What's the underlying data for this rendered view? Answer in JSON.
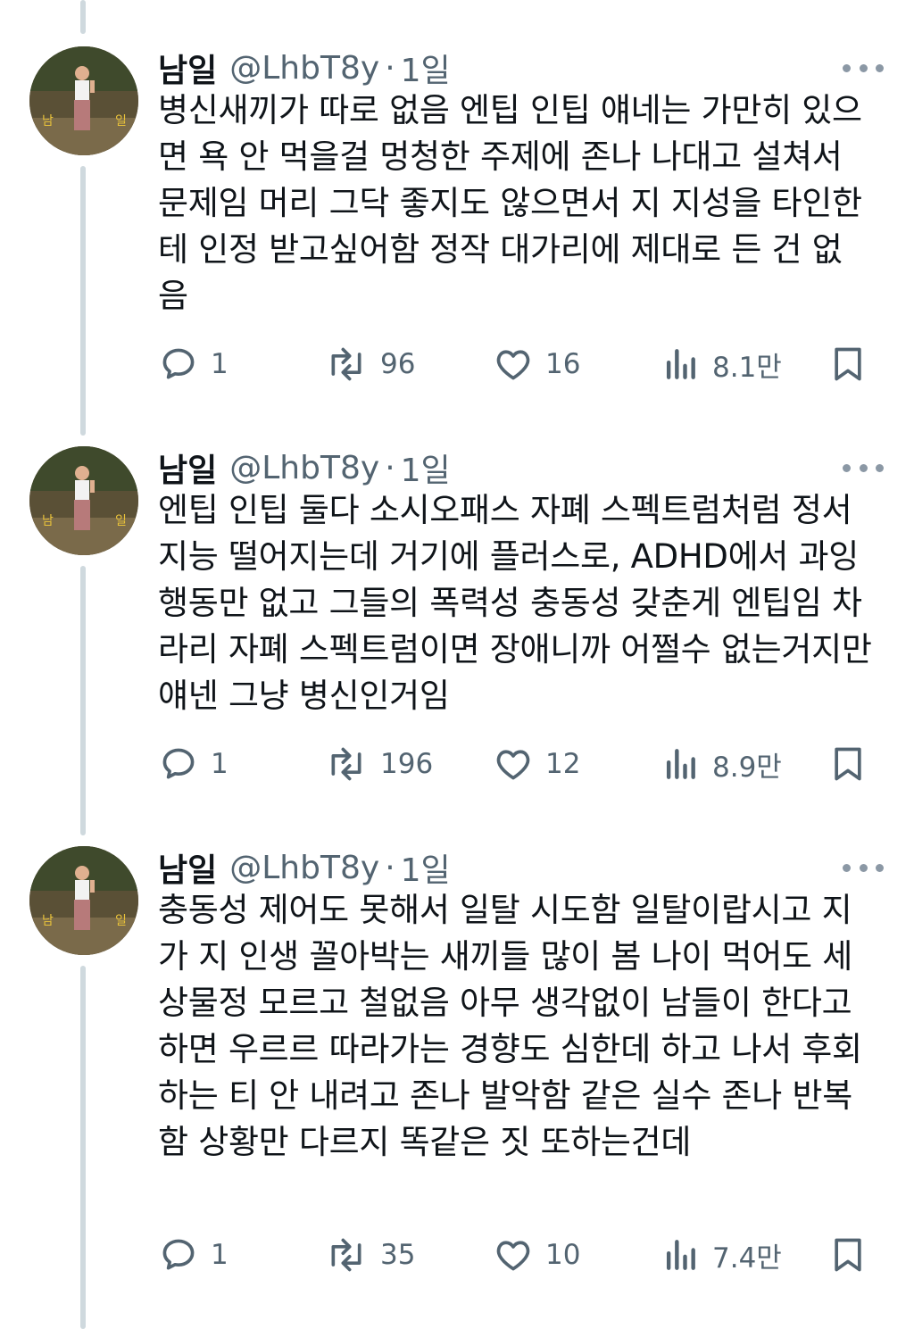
{
  "tweets": [
    {
      "name": "남일",
      "handle": "@LhbT8y",
      "separator": "·",
      "time": "1일",
      "text": "병신새끼가 따로 없음 엔팁 인팁 얘네는 가만히 있으면 욕 안 먹을걸 멍청한 주제에 존나 나대고 설쳐서 문제임 머리 그닥 좋지도 않으면서 지 지성을 타인한테 인정 받고싶어함 정작 대가리에 제대로 든 건 없음",
      "replies": "1",
      "retweets": "96",
      "likes": "16",
      "views": "8.1만"
    },
    {
      "name": "남일",
      "handle": "@LhbT8y",
      "separator": "·",
      "time": "1일",
      "text": "엔팁 인팁 둘다 소시오패스 자폐 스펙트럼처럼 정서지능 떨어지는데 거기에 플러스로, ADHD에서 과잉행동만 없고 그들의 폭력성 충동성 갖춘게 엔팁임 차라리 자폐 스펙트럼이면 장애니까 어쩔수 없는거지만 얘넨 그냥 병신인거임",
      "replies": "1",
      "retweets": "196",
      "likes": "12",
      "views": "8.9만"
    },
    {
      "name": "남일",
      "handle": "@LhbT8y",
      "separator": "·",
      "time": "1일",
      "text": "충동성 제어도 못해서 일탈 시도함 일탈이랍시고 지가 지 인생 꼴아박는 새끼들 많이 봄 나이 먹어도 세상물정 모르고 철없음 아무 생각없이 남들이 한다고 하면 우르르 따라가는 경향도 심한데 하고 나서 후회하는 티 안 내려고 존나 발악함 같은 실수 존나 반복함 상황만 다르지 똑같은 짓 또하는건데",
      "replies": "1",
      "retweets": "35",
      "likes": "10",
      "views": "7.4만"
    }
  ],
  "icons": {
    "reply": "reply-icon",
    "retweet": "retweet-icon",
    "like": "heart-icon",
    "views": "views-icon",
    "bookmark": "bookmark-icon",
    "more": "more-icon"
  },
  "colors": {
    "text": "#0f1419",
    "secondary": "#536471",
    "thread_line": "#cfd9de"
  }
}
